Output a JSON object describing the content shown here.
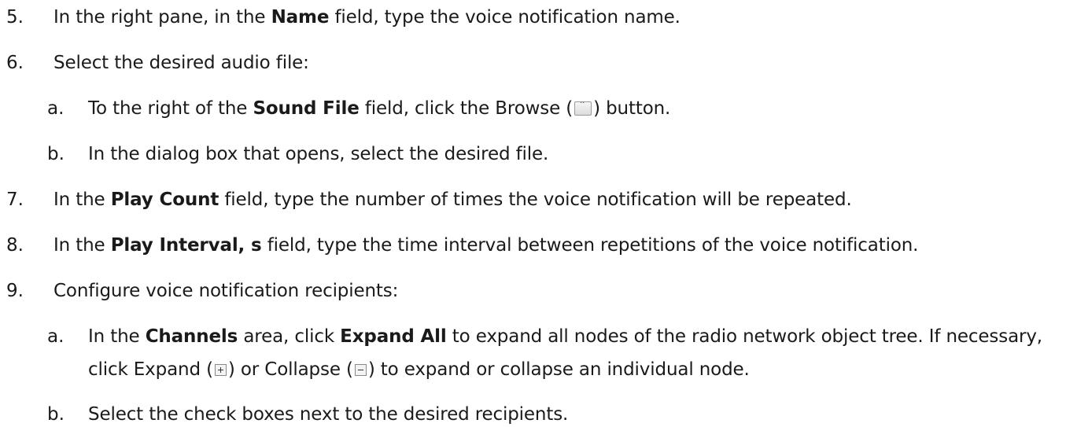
{
  "steps": [
    {
      "num": "5.",
      "pre": "In the right pane, in the ",
      "bold": "Name",
      "post": " field, type the voice notification name."
    },
    {
      "num": "6.",
      "text": "Select the desired audio file:"
    },
    {
      "num": "7.",
      "pre": "In the ",
      "bold": "Play Count",
      "post": " field, type the number of times the voice notification will be repeated."
    },
    {
      "num": "8.",
      "pre": "In the ",
      "bold": "Play Interval, s",
      "post": " field, type the time interval between repetitions of the voice notification."
    },
    {
      "num": "9.",
      "text": "Configure voice notification recipients:"
    }
  ],
  "substeps_6": [
    {
      "letter": "a.",
      "pre": "To the right of the ",
      "bold": "Sound File",
      "mid": " field, click the Browse (",
      "post": ") button."
    },
    {
      "letter": "b.",
      "text": "In the dialog box that opens, select the desired file."
    }
  ],
  "substeps_9": [
    {
      "letter": "a.",
      "pre": "In the ",
      "bold1": "Channels",
      "mid": " area, click ",
      "bold2": "Expand All",
      "post": " to expand all nodes of the radio network object tree. If necessary,",
      "line2_pre": "click Expand (",
      "line2_mid": ") or Collapse (",
      "line2_post": ") to expand or collapse an individual node."
    },
    {
      "letter": "b.",
      "text": "Select the check boxes next to the desired recipients."
    }
  ],
  "icons": {
    "browse": "browse-button-icon",
    "expand": "expand-plus-icon",
    "collapse": "collapse-minus-icon"
  }
}
